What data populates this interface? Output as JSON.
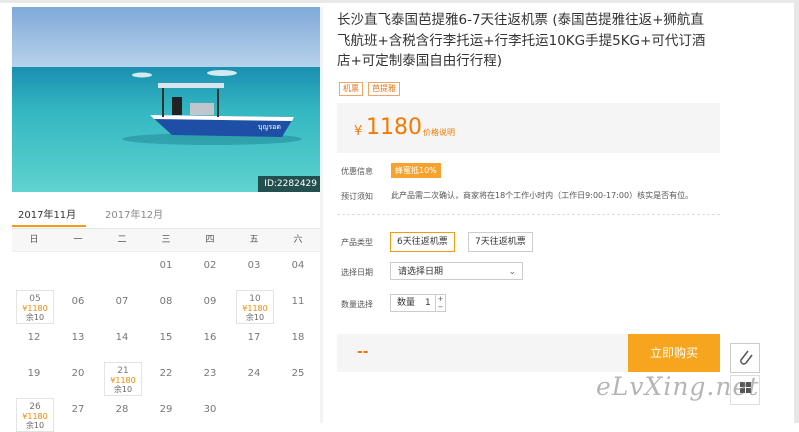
{
  "photo": {
    "id_label": "ID:2282429",
    "boat_text": "บุญรอด"
  },
  "calendar": {
    "tabs": [
      "2017年11月",
      "2017年12月"
    ],
    "weekdays": [
      "日",
      "一",
      "二",
      "三",
      "四",
      "五",
      "六"
    ],
    "weeks": [
      [
        null,
        null,
        null,
        {
          "day": "01"
        },
        {
          "day": "02"
        },
        {
          "day": "03"
        },
        {
          "day": "04"
        }
      ],
      [
        {
          "day": "05",
          "price": "¥1180",
          "left": "余10"
        },
        {
          "day": "06"
        },
        {
          "day": "07"
        },
        {
          "day": "08"
        },
        {
          "day": "09"
        },
        {
          "day": "10",
          "price": "¥1180",
          "left": "余10"
        },
        {
          "day": "11"
        }
      ],
      [
        {
          "day": "12"
        },
        {
          "day": "13"
        },
        {
          "day": "14"
        },
        {
          "day": "15"
        },
        {
          "day": "16"
        },
        {
          "day": "17"
        },
        {
          "day": "18"
        }
      ],
      [
        {
          "day": "19"
        },
        {
          "day": "20"
        },
        {
          "day": "21",
          "price": "¥1180",
          "left": "余10"
        },
        {
          "day": "22"
        },
        {
          "day": "23"
        },
        {
          "day": "24"
        },
        {
          "day": "25"
        }
      ],
      [
        {
          "day": "26",
          "price": "¥1180",
          "left": "余10"
        },
        {
          "day": "27"
        },
        {
          "day": "28"
        },
        {
          "day": "29"
        },
        {
          "day": "30"
        },
        null,
        null
      ]
    ]
  },
  "product": {
    "title": "长沙直飞泰国芭提雅6-7天往返机票 (泰国芭提雅往返+狮航直飞航班+含税含行李托运+行李托运10KG手提5KG+可代订酒店+可定制泰国自由行行程)",
    "tags": [
      "机票",
      "芭提雅"
    ],
    "currency": "¥",
    "price": "1180",
    "price_explain": "价格说明",
    "promo_label": "优惠信息",
    "promo": "蜂蜜抵10%",
    "notice_label": "预订须知",
    "notice": "此产品需二次确认，商家将在18个工作小时内（工作日9:00-17:00）核实是否有位。",
    "type_label": "产品类型",
    "type_options": [
      "6天往返机票",
      "7天往返机票"
    ],
    "date_label": "选择日期",
    "date_placeholder": "请选择日期",
    "qty_label": "数量选择",
    "qty_prefix": "数量",
    "qty_value": "1",
    "buy_dashes": "--",
    "buy_button": "立即购买"
  },
  "watermark": "eLvXing.net",
  "colors": {
    "accent": "#f7a51e",
    "price": "#f27a00",
    "sea": "#3cbfc6"
  }
}
